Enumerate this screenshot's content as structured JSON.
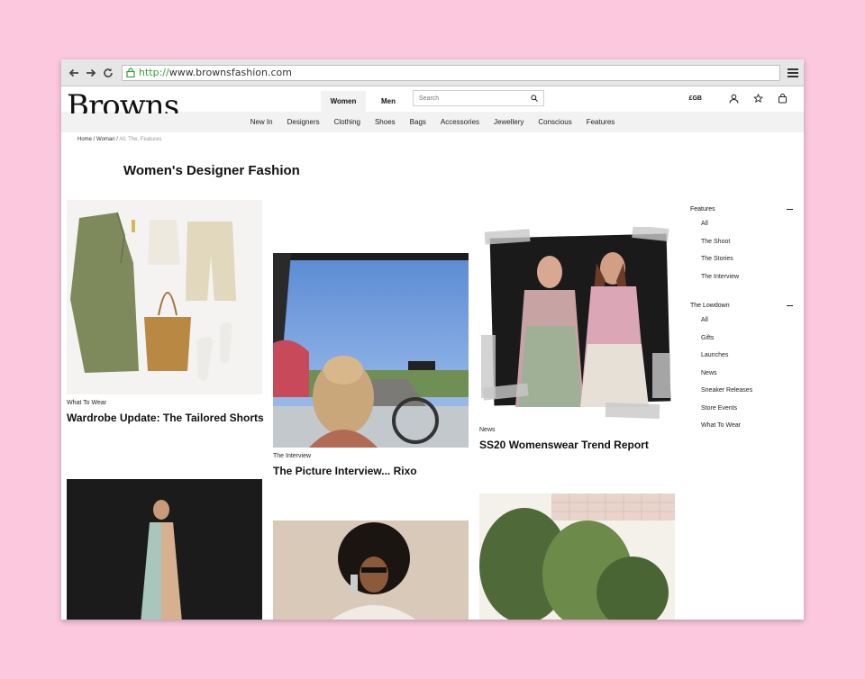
{
  "browser": {
    "url_protocol": "http://",
    "url_rest": "www.brownsfashion.com"
  },
  "header": {
    "logo": "Browns",
    "tabs": [
      {
        "label": "Women",
        "active": true
      },
      {
        "label": "Men",
        "active": false
      }
    ],
    "search_placeholder": "Search",
    "currency": "£GB"
  },
  "nav": {
    "items": [
      "New In",
      "Designers",
      "Clothing",
      "Shoes",
      "Bags",
      "Accessories",
      "Jewellery",
      "Conscious",
      "Features"
    ]
  },
  "breadcrumb": {
    "home": "Home",
    "sep1": " / ",
    "woman": "Woman",
    "sep2": " / ",
    "current": "All, The, Features"
  },
  "page_title": "Women's Designer Fashion",
  "cards": [
    {
      "category": "What To Wear",
      "title": "Wardrobe Update: The Tailored Shorts"
    },
    {
      "category": "The Interview",
      "title": "The Picture Interview... Rixo"
    },
    {
      "category": "News",
      "title": "SS20 Womenswear Trend Report"
    }
  ],
  "sidebar": {
    "sections": [
      {
        "title": "Features",
        "items": [
          "All",
          "The Shoot",
          "The Stories",
          "The Interview"
        ]
      },
      {
        "title": "The Lowdown",
        "items": [
          "All",
          "Gifts",
          "Launches",
          "News",
          "Sneaker Releases",
          "Store Events",
          "What To Wear"
        ]
      }
    ]
  },
  "colors": {
    "background": "#fbc8dd",
    "url_protocol": "#3a9b3a",
    "nav_bar": "#f2f2f2"
  }
}
